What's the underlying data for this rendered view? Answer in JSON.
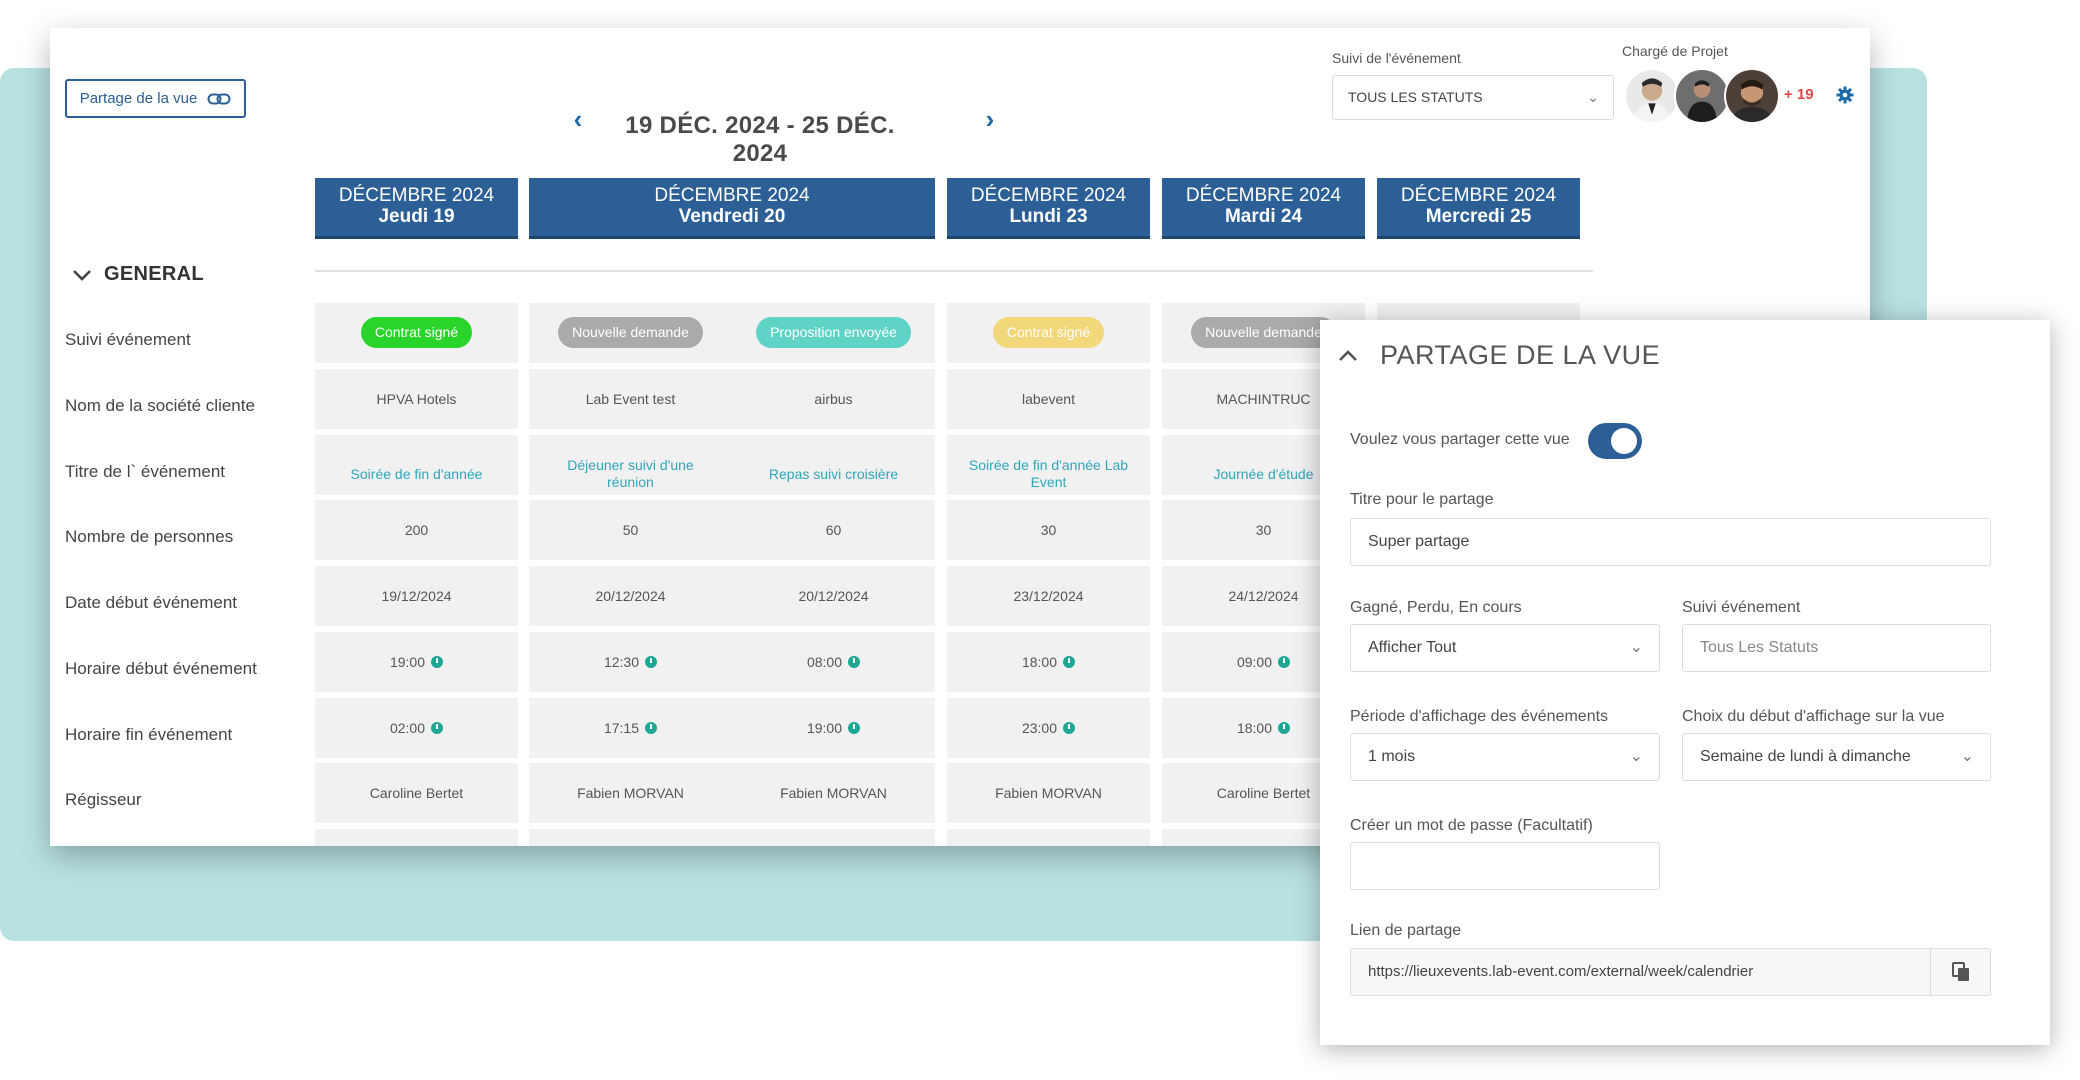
{
  "toolbar": {
    "share_button_label": "Partage de la vue",
    "date_range": "19 DÉC. 2024 - 25 DÉC. 2024",
    "prev_icon": "chevron-left-icon",
    "next_icon": "chevron-right-icon",
    "suivi_label": "Suivi de l'événement",
    "suivi_value": "TOUS LES STATUTS",
    "charge_label": "Chargé de Projet",
    "more_avatars": "+ 19",
    "accent_color": "#2c5f95"
  },
  "days": [
    {
      "month": "DÉCEMBRE 2024",
      "day": "Jeudi 19"
    },
    {
      "month": "DÉCEMBRE 2024",
      "day": "Vendredi 20"
    },
    {
      "month": "DÉCEMBRE 2024",
      "day": "Lundi 23"
    },
    {
      "month": "DÉCEMBRE 2024",
      "day": "Mardi 24"
    },
    {
      "month": "DÉCEMBRE 2024",
      "day": "Mercredi 25"
    }
  ],
  "section": {
    "title": "GENERAL"
  },
  "row_labels": [
    "Suivi événement",
    "Nom de la société cliente",
    "Titre de l` événement",
    "Nombre de personnes",
    "Date début événement",
    "Horaire début événement",
    "Horaire fin événement",
    "Régisseur"
  ],
  "events": [
    {
      "status": "Contrat signé",
      "status_color": "#2bd42b",
      "client": "HPVA Hotels",
      "title": "Soirée de fin d'année",
      "people": "200",
      "date": "19/12/2024",
      "start": "19:00",
      "end": "02:00",
      "manager": "Caroline Bertet"
    },
    {
      "status": "Nouvelle demande",
      "status_color": "#a9aba8",
      "client": "Lab Event test",
      "title": "Déjeuner suivi d'une réunion",
      "people": "50",
      "date": "20/12/2024",
      "start": "12:30",
      "end": "17:15",
      "manager": "Fabien MORVAN"
    },
    {
      "status": "Proposition envoyée",
      "status_color": "#5fd4c6",
      "client": "airbus",
      "title": "Repas suivi croisière",
      "people": "60",
      "date": "20/12/2024",
      "start": "08:00",
      "end": "19:00",
      "manager": "Fabien MORVAN"
    },
    {
      "status": "Contrat signé",
      "status_color": "#f2d77b",
      "client": "labevent",
      "title": "Soirée de fin d'année Lab Event",
      "people": "30",
      "date": "23/12/2024",
      "start": "18:00",
      "end": "23:00",
      "manager": "Fabien MORVAN"
    },
    {
      "status": "Nouvelle demande",
      "status_color": "#a9aba8",
      "client": "MACHINTRUC",
      "title": "Journée d'étude",
      "people": "30",
      "date": "24/12/2024",
      "start": "09:00",
      "end": "18:00",
      "manager": "Caroline Bertet"
    }
  ],
  "share": {
    "title": "PARTAGE DE LA VUE",
    "toggle_question": "Voulez vous partager cette vue",
    "toggle_on": true,
    "title_label": "Titre pour le partage",
    "title_value": "Super partage",
    "outcome_label": "Gagné, Perdu, En cours",
    "outcome_value": "Afficher Tout",
    "suivi_label": "Suivi événement",
    "suivi_placeholder": "Tous Les Statuts",
    "period_label": "Période d'affichage des événements",
    "period_value": "1 mois",
    "start_label": "Choix du début d'affichage sur la vue",
    "start_value": "Semaine de lundi à dimanche",
    "password_label": "Créer un mot de passe (Facultatif)",
    "password_value": "",
    "link_label": "Lien de partage",
    "link_value": "https://lieuxevents.lab-event.com/external/week/calendrier"
  }
}
